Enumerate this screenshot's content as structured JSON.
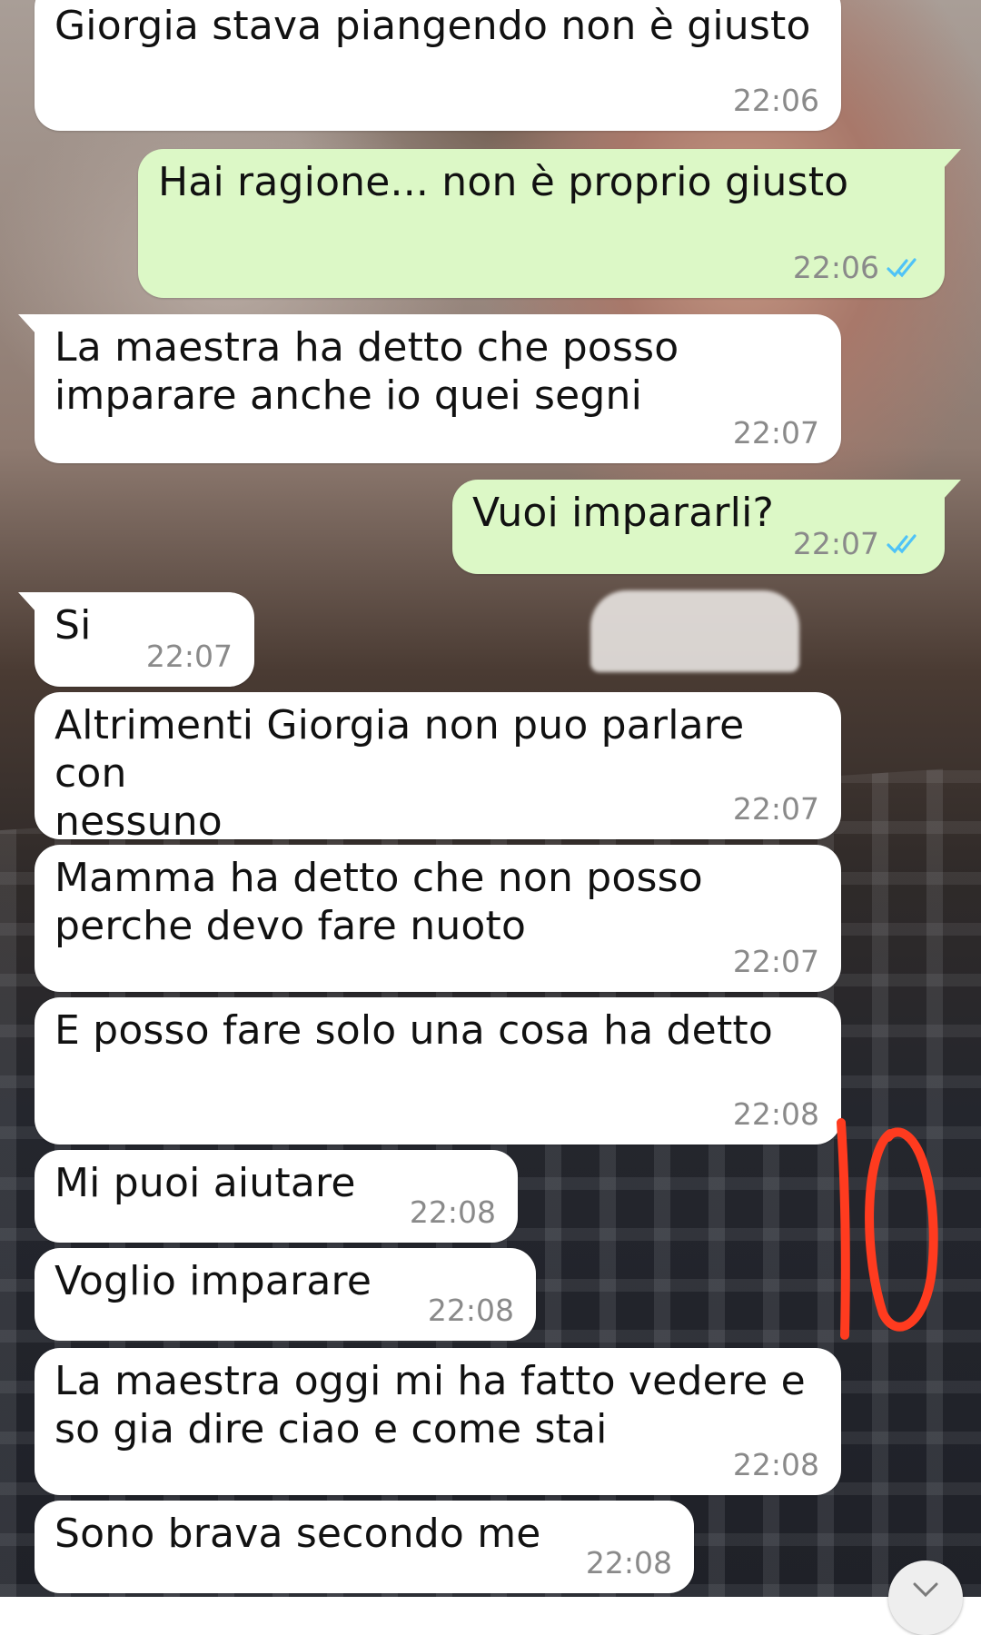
{
  "chat": {
    "messages": [
      {
        "dir": "in",
        "text": "Giorgia stava piangendo non è giusto",
        "time": "22:06"
      },
      {
        "dir": "out",
        "text": "Hai ragione... non è proprio giusto",
        "time": "22:06",
        "status": "read"
      },
      {
        "dir": "in",
        "text": "La maestra ha detto che posso\nimparare anche io quei segni",
        "time": "22:07"
      },
      {
        "dir": "out",
        "text": "Vuoi impararli?",
        "time": "22:07",
        "status": "read"
      },
      {
        "dir": "in",
        "text": "Si",
        "time": "22:07"
      },
      {
        "dir": "in",
        "text": "Altrimenti Giorgia non puo parlare con\nnessuno",
        "time": "22:07"
      },
      {
        "dir": "in",
        "text": "Mamma ha detto che non posso\nperche devo fare nuoto",
        "time": "22:07"
      },
      {
        "dir": "in",
        "text": "E posso fare solo una cosa ha detto",
        "time": "22:08"
      },
      {
        "dir": "in",
        "text": "Mi puoi aiutare",
        "time": "22:08"
      },
      {
        "dir": "in",
        "text": "Voglio imparare",
        "time": "22:08"
      },
      {
        "dir": "in",
        "text": "La maestra oggi mi ha fatto vedere e\nso gia dire ciao e come stai",
        "time": "22:08"
      },
      {
        "dir": "in",
        "text": "Sono brava secondo me",
        "time": "22:08"
      }
    ]
  },
  "annotation": {
    "text": "10",
    "color": "#ff3b1f"
  },
  "colors": {
    "incoming_bubble": "#ffffff",
    "outgoing_bubble": "#dcf8c6",
    "read_ticks": "#4fc3f7",
    "time_text": "#8a8a8a"
  },
  "icons": {
    "read_status": "double-check-icon",
    "scroll_down": "chevron-down-icon"
  }
}
